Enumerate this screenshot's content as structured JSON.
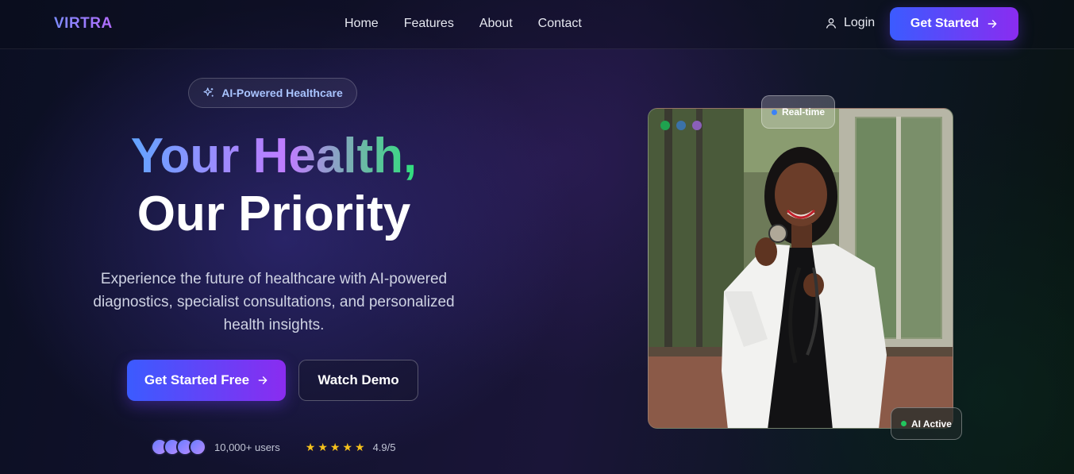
{
  "nav": {
    "logo": "VIRTRA",
    "links": [
      "Home",
      "Features",
      "About",
      "Contact"
    ],
    "login": "Login",
    "cta": "Get Started"
  },
  "hero": {
    "badge": "AI-Powered Healthcare",
    "headline_1": "Your Health,",
    "headline_2": "Our Priority",
    "subtitle": "Experience the future of healthcare with AI-powered diagnostics, specialist consultations, and personalized health insights.",
    "cta_primary": "Get Started Free",
    "cta_secondary": "Watch Demo",
    "users": "10,000+ users",
    "rating": "4.9/5",
    "stars": 5
  },
  "image": {
    "chip_realtime": "Real-time",
    "chip_ai": "AI Active",
    "window_dots": [
      "#22c55e",
      "#3b82f6",
      "#a855f7"
    ]
  },
  "colors": {
    "accent_start": "#3b5bff",
    "accent_end": "#8a2cf0",
    "star": "#f6c21c",
    "status_green": "#22c55e",
    "realtime_blue": "#3b82f6"
  },
  "icons": {
    "login": "user-icon",
    "badge": "sparkles-icon",
    "cta": "arrow-right-icon",
    "rating": "star-icon"
  }
}
